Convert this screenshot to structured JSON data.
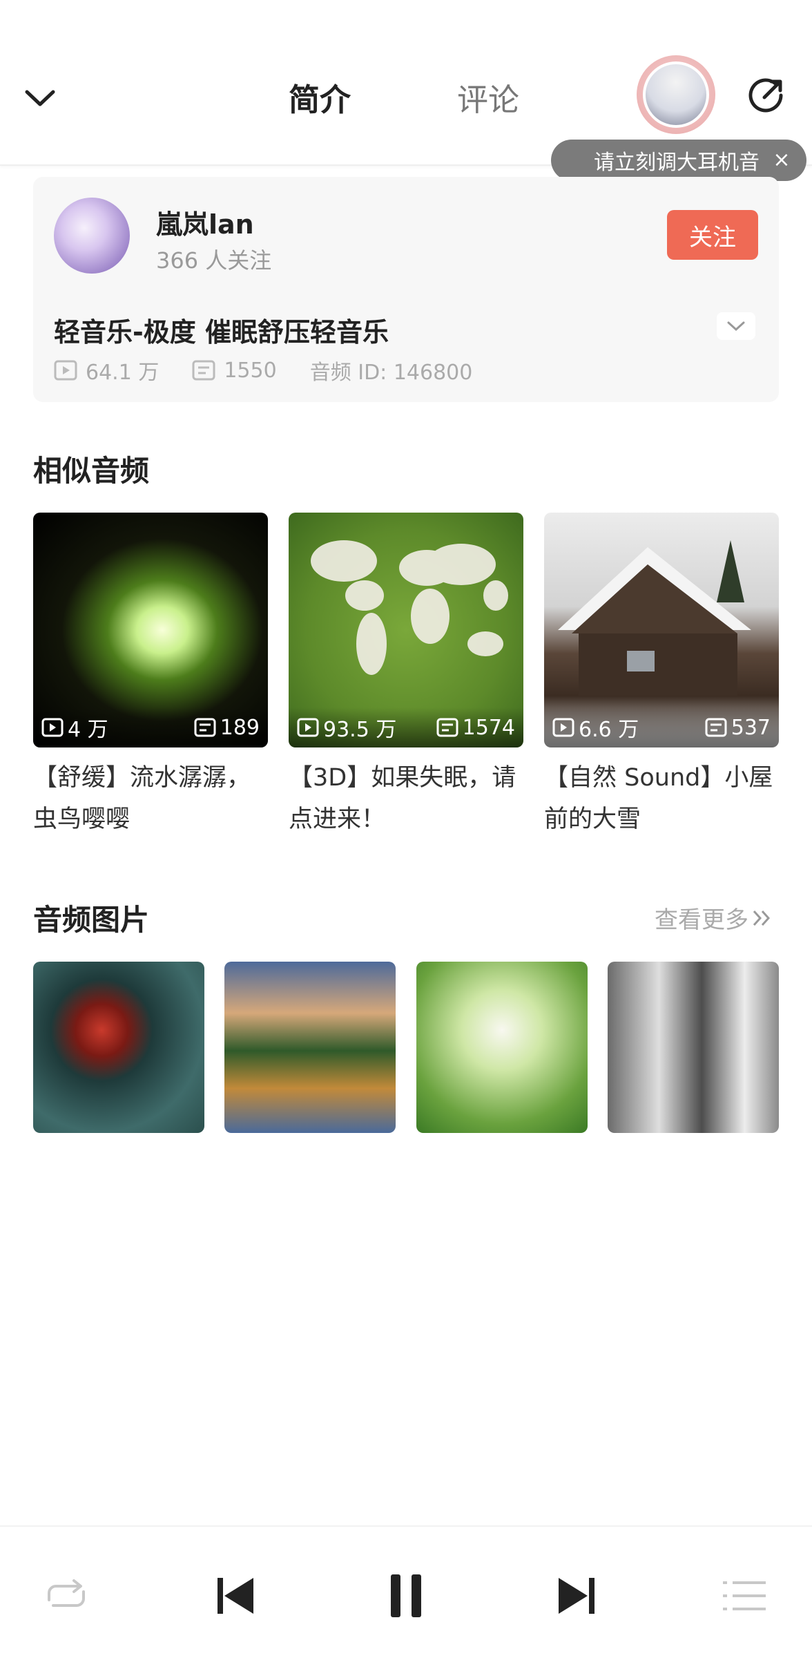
{
  "header": {
    "tabs": [
      {
        "label": "简介",
        "active": true
      },
      {
        "label": "评论",
        "active": false
      }
    ],
    "icons": {
      "back": "chevron-down-icon",
      "share": "share-icon"
    }
  },
  "tooltip": {
    "text": "请立刻调大耳机音",
    "close": "×"
  },
  "author": {
    "name": "嵐岚lan",
    "followers": "366 人关注",
    "follow_label": "关注"
  },
  "audio": {
    "title": "轻音乐-极度 催眠舒压轻音乐",
    "plays": "64.1 万",
    "comments": "1550",
    "id_text": "音频 ID: 146800"
  },
  "similar": {
    "heading": "相似音频",
    "items": [
      {
        "plays": "4 万",
        "comments": "189",
        "title": "【舒缓】流水潺潺，虫鸟嘤嘤"
      },
      {
        "plays": "93.5 万",
        "comments": "1574",
        "title": "【3D】如果失眠，请点进来！"
      },
      {
        "plays": "6.6 万",
        "comments": "537",
        "title": "【自然 Sound】小屋前的大雪"
      }
    ]
  },
  "gallery": {
    "heading": "音频图片",
    "more": "查看更多",
    "images": [
      "butterfly",
      "mountain-lake",
      "clover-flowers",
      "snowy-forest"
    ]
  },
  "player": {
    "icons": [
      "repeat-icon",
      "previous-icon",
      "pause-icon",
      "next-icon",
      "playlist-icon"
    ]
  },
  "colors": {
    "accent": "#ef6a55",
    "tab_underline": "#f06e6e",
    "muted": "#9a9a9a"
  }
}
